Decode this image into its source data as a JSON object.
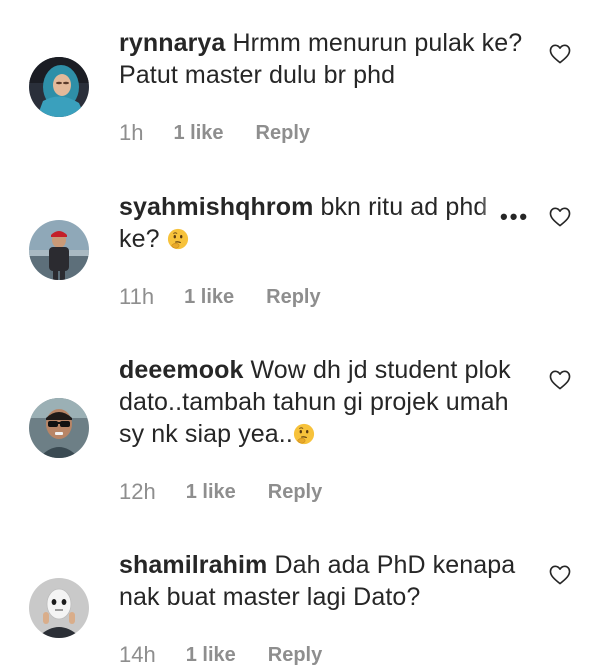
{
  "comments": [
    {
      "username": "rynnarya",
      "text": "Hrmm menurun pulak ke? Patut master dulu br phd",
      "time": "1h",
      "likes": "1 like",
      "reply": "Reply",
      "avatar_icon": "avatar-woman-hijab"
    },
    {
      "username": "syahmishqhrom",
      "text": "bkn ritu ad phd ke?",
      "emoji": "thinking-face",
      "time": "11h",
      "likes": "1 like",
      "reply": "Reply",
      "avatar_icon": "avatar-man-red-cap",
      "more_icon": "•••"
    },
    {
      "username": "deeemook",
      "text": "Wow dh jd student plok dato..tambah tahun gi projek umah sy nk siap yea..",
      "emoji": "thinking-face",
      "time": "12h",
      "likes": "1 like",
      "reply": "Reply",
      "avatar_icon": "avatar-man-sunglasses"
    },
    {
      "username": "shamilrahim",
      "text": "Dah ada PhD kenapa nak buat master lagi Dato?",
      "time": "14h",
      "likes": "1 like",
      "reply": "Reply",
      "avatar_icon": "avatar-white-mask"
    }
  ],
  "colors": {
    "text": "#262626",
    "meta": "#8e8e8e",
    "heart_stroke": "#262626",
    "background": "#ffffff"
  },
  "icons": {
    "like": "heart-outline-icon",
    "more": "more-options-icon",
    "emoji": "thinking-face-emoji"
  }
}
